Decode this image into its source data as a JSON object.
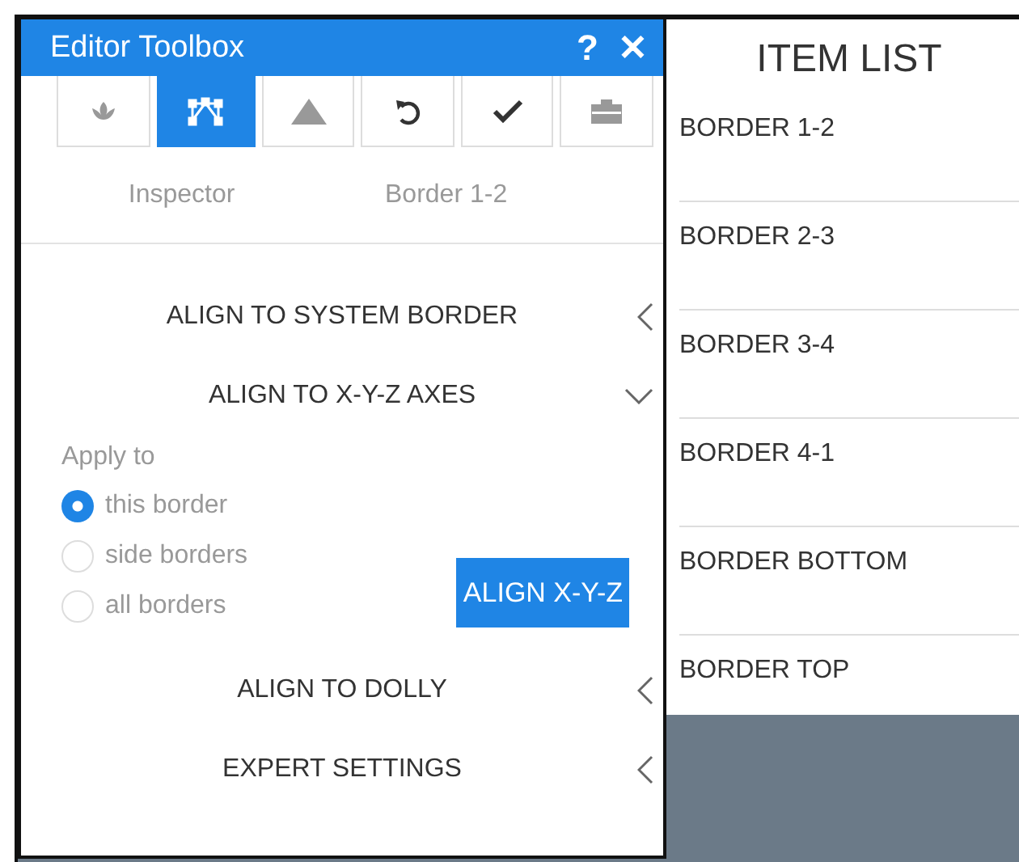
{
  "toolbox": {
    "title": "Editor Toolbox",
    "help": "?",
    "close": "✕",
    "tools": [
      {
        "kind": "lotus",
        "selected": false
      },
      {
        "kind": "nodes",
        "selected": true
      },
      {
        "kind": "mountain",
        "selected": false
      },
      {
        "kind": "undo",
        "selected": false
      },
      {
        "kind": "check",
        "selected": false
      },
      {
        "kind": "toolbox",
        "selected": false
      }
    ],
    "info": [
      "Inspector",
      "Border 1-2"
    ],
    "sections": [
      {
        "title": "ALIGN TO SYSTEM BORDER",
        "expanded": false
      },
      {
        "title": "ALIGN TO X-Y-Z AXES",
        "expanded": true,
        "content": {
          "label": "Apply to",
          "options": [
            {
              "label": "this border",
              "selected": true
            },
            {
              "label": "side borders",
              "selected": false
            },
            {
              "label": "all borders",
              "selected": false
            }
          ],
          "button": "ALIGN X-Y-Z"
        }
      },
      {
        "title": "ALIGN TO DOLLY",
        "expanded": false
      },
      {
        "title": "EXPERT SETTINGS",
        "expanded": false
      }
    ]
  },
  "item_list": {
    "title": "ITEM LIST",
    "items": [
      "BORDER 1-2",
      "BORDER 2-3",
      "BORDER 3-4",
      "BORDER 4-1",
      "BORDER BOTTOM",
      "BORDER TOP"
    ]
  }
}
